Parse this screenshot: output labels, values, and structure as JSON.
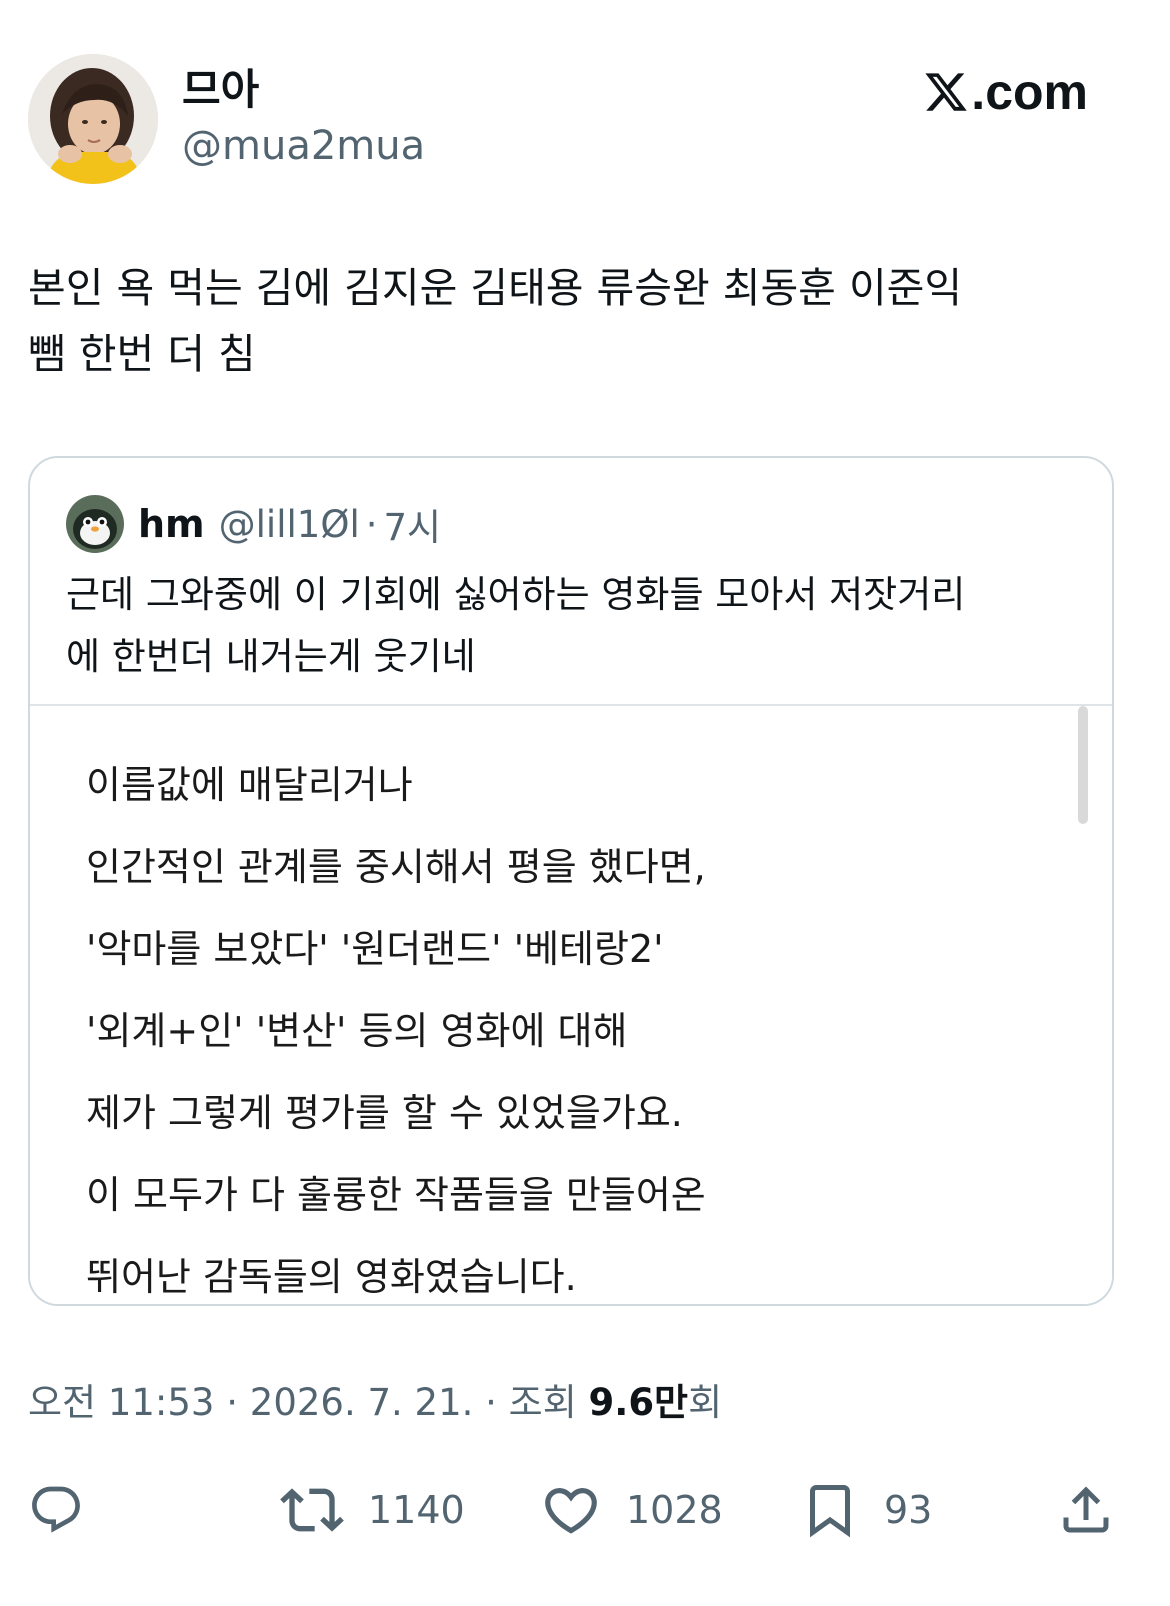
{
  "header": {
    "display_name": "므아",
    "handle": "@mua2mua",
    "brand_text": ".com"
  },
  "tweet": {
    "lines": [
      "본인 욕 먹는 김에 김지운 김태용 류승완 최동훈 이준익",
      "뺌 한번 더 침"
    ]
  },
  "quote": {
    "name": "hm",
    "handle": "@lill1Øl",
    "separator": "·",
    "time": "7시",
    "lines": [
      "근데 그와중에 이 기회에 싫어하는 영화들 모아서 저잣거리",
      "에 한번더 내거는게 웃기네"
    ],
    "image_lines": [
      "이름값에 매달리거나",
      "인간적인 관계를 중시해서 평을 했다면,",
      "'악마를 보았다' '원더랜드' '베테랑2'",
      "'외계+인' '변산' 등의 영화에 대해",
      "제가 그렇게 평가를 할 수 있었을가요.",
      "이 모두가 다 훌륭한 작품들을 만들어온",
      "뛰어난 감독들의 영화였습니다."
    ]
  },
  "meta": {
    "time": "오전 11:53",
    "sep1": " · ",
    "date": "2026. 7. 21.",
    "sep2": " · ",
    "views_label": "조회 ",
    "views_count": "9.6만",
    "views_suffix": "회"
  },
  "actions": {
    "reply_icon": "reply-icon",
    "retweet_icon": "retweet-icon",
    "retweet_count": "1140",
    "like_icon": "heart-icon",
    "like_count": "1028",
    "bookmark_icon": "bookmark-icon",
    "bookmark_count": "93",
    "share_icon": "share-icon"
  },
  "colors": {
    "text_primary": "#0f1419",
    "text_secondary": "#536471",
    "border": "#cfd9de"
  }
}
